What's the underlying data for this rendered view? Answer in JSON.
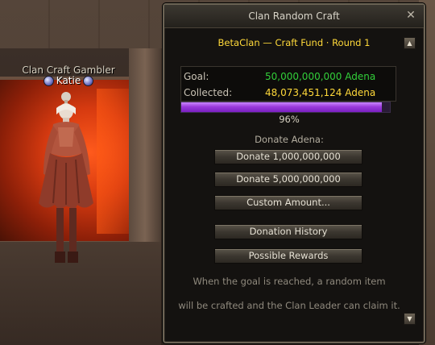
{
  "npc": {
    "title": "Clan Craft Gambler",
    "name": "Katie"
  },
  "window": {
    "title": "Clan Random Craft",
    "close_icon": "close-icon",
    "subtitle": "BetaClan — Craft Fund · Round 1",
    "goal_label": "Goal:",
    "goal_value": "50,000,000,000 Adena",
    "collected_label": "Collected:",
    "collected_value": "48,073,451,124 Adena",
    "progress_fraction": 0.96,
    "progress_text": "96%",
    "donate_label": "Donate Adena:",
    "buttons": {
      "donate_1b": "Donate 1,000,000,000",
      "donate_5b": "Donate 5,000,000,000",
      "custom": "Custom Amount...",
      "history": "Donation History",
      "rewards": "Possible Rewards"
    },
    "info_line1": "When the goal is reached, a random item",
    "info_line2": "will be crafted and the Clan Leader can claim it."
  },
  "colors": {
    "goal_value": "#32cf3a",
    "collected_value": "#ffd93a",
    "subtitle": "#ffd93a",
    "progress_fill": "#9b3bdb"
  }
}
